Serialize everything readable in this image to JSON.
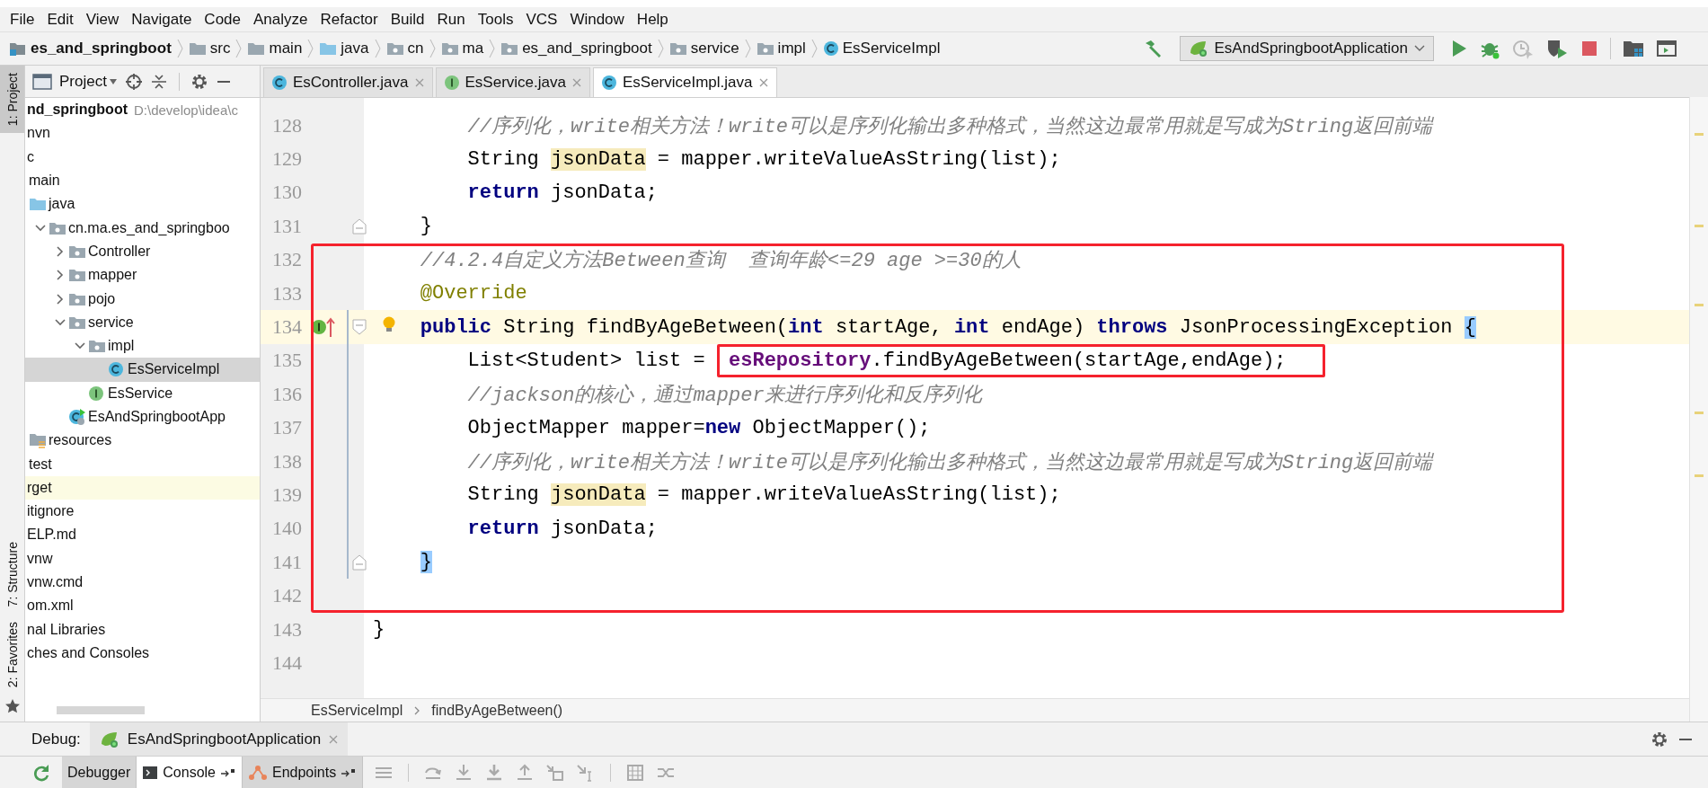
{
  "menu": [
    "File",
    "Edit",
    "View",
    "Navigate",
    "Code",
    "Analyze",
    "Refactor",
    "Build",
    "Run",
    "Tools",
    "VCS",
    "Window",
    "Help"
  ],
  "nav_bar": {
    "crumbs": [
      {
        "label": "es_and_springboot",
        "kind": "project"
      },
      {
        "label": "src",
        "kind": "folder"
      },
      {
        "label": "main",
        "kind": "folder"
      },
      {
        "label": "java",
        "kind": "source"
      },
      {
        "label": "cn",
        "kind": "package"
      },
      {
        "label": "ma",
        "kind": "package"
      },
      {
        "label": "es_and_springboot",
        "kind": "package"
      },
      {
        "label": "service",
        "kind": "package"
      },
      {
        "label": "impl",
        "kind": "package"
      },
      {
        "label": "EsServiceImpl",
        "kind": "class"
      }
    ],
    "run_config": "EsAndSpringbootApplication"
  },
  "side_stripe": [
    {
      "label": "1: Project",
      "selected": true
    },
    {
      "label": "7: Structure",
      "selected": false
    },
    {
      "label": "2: Favorites",
      "selected": false
    }
  ],
  "project_panel": {
    "title": "Project",
    "tree": [
      {
        "label": "nd_springboot",
        "path": "D:\\develop\\idea\\c",
        "selected": false,
        "ignored": false,
        "children": [
          {
            "label": "nvn",
            "selected": false,
            "ignored": false
          },
          {
            "label": "c",
            "selected": false,
            "ignored": false,
            "children": [
              {
                "label": "main",
                "selected": false,
                "ignored": false,
                "children": [
                  {
                    "label": "java",
                    "kind": "source",
                    "selected": false,
                    "ignored": false,
                    "children": [
                      {
                        "label": "cn.ma.es_and_springboo",
                        "kind": "package",
                        "expanded": true,
                        "selected": false,
                        "ignored": false,
                        "children": [
                          {
                            "label": "Controller",
                            "kind": "package",
                            "expanded": false,
                            "selected": false,
                            "ignored": false
                          },
                          {
                            "label": "mapper",
                            "kind": "package",
                            "expanded": false,
                            "selected": false,
                            "ignored": false
                          },
                          {
                            "label": "pojo",
                            "kind": "package",
                            "expanded": false,
                            "selected": false,
                            "ignored": false
                          },
                          {
                            "label": "service",
                            "kind": "package",
                            "expanded": true,
                            "selected": false,
                            "ignored": false,
                            "children": [
                              {
                                "label": "impl",
                                "kind": "package",
                                "expanded": true,
                                "selected": false,
                                "ignored": false,
                                "children": [
                                  {
                                    "label": "EsServiceImpl",
                                    "kind": "class",
                                    "selected": true,
                                    "ignored": false
                                  }
                                ]
                              },
                              {
                                "label": "EsService",
                                "kind": "interface",
                                "selected": false,
                                "ignored": false
                              }
                            ]
                          },
                          {
                            "label": "EsAndSpringbootApp",
                            "kind": "spring-class",
                            "selected": false,
                            "ignored": false
                          }
                        ]
                      }
                    ]
                  },
                  {
                    "label": "resources",
                    "kind": "resources",
                    "selected": false,
                    "ignored": false
                  }
                ]
              },
              {
                "label": "test",
                "selected": false,
                "ignored": false
              }
            ]
          },
          {
            "label": "rget",
            "selected": false,
            "ignored": true
          },
          {
            "label": "itignore",
            "selected": false,
            "ignored": false
          },
          {
            "label": "ELP.md",
            "selected": false,
            "ignored": false
          },
          {
            "label": "vnw",
            "selected": false,
            "ignored": false
          },
          {
            "label": "vnw.cmd",
            "selected": false,
            "ignored": false
          },
          {
            "label": "om.xml",
            "selected": false,
            "ignored": false
          }
        ]
      },
      {
        "label": "nal Libraries",
        "selected": false,
        "ignored": false
      },
      {
        "label": "ches and Consoles",
        "selected": false,
        "ignored": false
      }
    ]
  },
  "tabs": [
    {
      "label": "EsController.java",
      "kind": "class",
      "selected": false
    },
    {
      "label": "EsService.java",
      "kind": "interface",
      "selected": false
    },
    {
      "label": "EsServiceImpl.java",
      "kind": "class",
      "selected": true
    }
  ],
  "editor": {
    "lines": [
      {
        "number": "128",
        "kind": "statement",
        "current": false,
        "framed": false,
        "changed": false,
        "tokens": [
          {
            "kind": "comment",
            "text": "//序列化，write相关方法！write可以是序列化输出多种格式，当然这边最常用就是写成为String返回前端"
          }
        ]
      },
      {
        "number": "129",
        "kind": "statement",
        "current": false,
        "framed": false,
        "changed": false,
        "tokens": [
          {
            "kind": "plain",
            "text": "String "
          },
          {
            "kind": "usage",
            "text": "jsonData"
          },
          {
            "kind": "plain",
            "text": " = mapper.writeValueAsString(list);"
          }
        ]
      },
      {
        "number": "130",
        "kind": "statement",
        "current": false,
        "framed": false,
        "changed": false,
        "tokens": [
          {
            "kind": "keyword",
            "text": "return"
          },
          {
            "kind": "plain",
            "text": " jsonData;"
          }
        ]
      },
      {
        "number": "131",
        "kind": "member",
        "current": false,
        "framed": false,
        "changed": false,
        "markers": [
          {
            "kind": "fold-end"
          }
        ],
        "tokens": [
          {
            "kind": "plain",
            "text": "}"
          }
        ]
      },
      {
        "number": "132",
        "kind": "member",
        "current": false,
        "framed": true,
        "changed": false,
        "tokens": [
          {
            "kind": "comment",
            "text": "//4.2.4自定义方法Between查询  查询年龄<=29 age >=30的人"
          }
        ]
      },
      {
        "number": "133",
        "kind": "member",
        "current": false,
        "framed": true,
        "changed": false,
        "tokens": [
          {
            "kind": "annotation",
            "text": "@Override"
          }
        ]
      },
      {
        "number": "134",
        "kind": "member",
        "current": true,
        "framed": true,
        "changed": true,
        "markers": [
          {
            "kind": "implements"
          },
          {
            "kind": "fold-start"
          },
          {
            "kind": "bulb"
          }
        ],
        "tokens": [
          {
            "kind": "keyword",
            "text": "public"
          },
          {
            "kind": "plain",
            "text": " String findByAgeBetween("
          },
          {
            "kind": "keyword",
            "text": "int"
          },
          {
            "kind": "plain",
            "text": " startAge, "
          },
          {
            "kind": "keyword",
            "text": "int"
          },
          {
            "kind": "plain",
            "text": " endAge) "
          },
          {
            "kind": "keyword",
            "text": "throws"
          },
          {
            "kind": "plain",
            "text": " JsonProcessingException "
          },
          {
            "kind": "brace",
            "text": "{"
          }
        ]
      },
      {
        "number": "135",
        "kind": "statement",
        "current": false,
        "framed": true,
        "changed": true,
        "tokens": [
          {
            "kind": "plain",
            "text": "List<Student> list =  "
          },
          {
            "kind": "field",
            "text": "esRepository",
            "boxed": true
          },
          {
            "kind": "plain",
            "text": ".findByAgeBetween(startAge,endAge);",
            "boxed": true
          }
        ]
      },
      {
        "number": "136",
        "kind": "statement",
        "current": false,
        "framed": true,
        "changed": true,
        "tokens": [
          {
            "kind": "comment",
            "text": "//jackson的核心，通过mapper来进行序列化和反序列化"
          }
        ]
      },
      {
        "number": "137",
        "kind": "statement",
        "current": false,
        "framed": true,
        "changed": true,
        "tokens": [
          {
            "kind": "plain",
            "text": "ObjectMapper mapper="
          },
          {
            "kind": "keyword",
            "text": "new"
          },
          {
            "kind": "plain",
            "text": " ObjectMapper();"
          }
        ]
      },
      {
        "number": "138",
        "kind": "statement",
        "current": false,
        "framed": true,
        "changed": true,
        "tokens": [
          {
            "kind": "comment",
            "text": "//序列化，write相关方法！write可以是序列化输出多种格式，当然这边最常用就是写成为String返回前端"
          }
        ]
      },
      {
        "number": "139",
        "kind": "statement",
        "current": false,
        "framed": true,
        "changed": true,
        "tokens": [
          {
            "kind": "plain",
            "text": "String "
          },
          {
            "kind": "usage",
            "text": "jsonData"
          },
          {
            "kind": "plain",
            "text": " = mapper.writeValueAsString(list);"
          }
        ]
      },
      {
        "number": "140",
        "kind": "statement",
        "current": false,
        "framed": true,
        "changed": true,
        "tokens": [
          {
            "kind": "keyword",
            "text": "return"
          },
          {
            "kind": "plain",
            "text": " jsonData;"
          }
        ]
      },
      {
        "number": "141",
        "kind": "member",
        "current": false,
        "framed": true,
        "changed": true,
        "markers": [
          {
            "kind": "fold-end"
          }
        ],
        "tokens": [
          {
            "kind": "brace",
            "text": "}"
          }
        ]
      },
      {
        "number": "142",
        "kind": "blank",
        "current": false,
        "framed": true,
        "changed": false
      },
      {
        "number": "143",
        "kind": "top",
        "current": false,
        "framed": false,
        "changed": false,
        "tokens": [
          {
            "kind": "plain",
            "text": "}"
          }
        ]
      },
      {
        "number": "144",
        "kind": "blank",
        "current": false,
        "framed": false,
        "changed": false
      }
    ],
    "breadcrumb": [
      "EsServiceImpl",
      "findByAgeBetween()"
    ]
  },
  "debug": {
    "label": "Debug:",
    "session": "EsAndSpringbootApplication",
    "tabs": [
      {
        "label": "Debugger",
        "kind": "plain",
        "selected": false
      },
      {
        "label": "Console",
        "kind": "console",
        "selected": true
      },
      {
        "label": "Endpoints",
        "kind": "endpoints",
        "selected": false
      }
    ]
  }
}
